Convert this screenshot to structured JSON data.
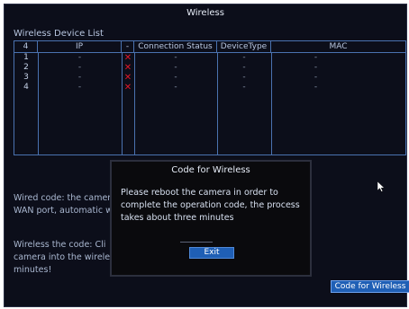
{
  "window": {
    "title": "Wireless"
  },
  "device_list": {
    "label": "Wireless Device List",
    "columns": [
      "4",
      "IP",
      "-",
      "Connection Status",
      "DeviceType",
      "MAC"
    ],
    "rows": [
      {
        "num": "1",
        "ip": "-",
        "status_mark": "✕",
        "connection": "-",
        "type": "-",
        "mac": "-"
      },
      {
        "num": "2",
        "ip": "-",
        "status_mark": "✕",
        "connection": "-",
        "type": "-",
        "mac": "-"
      },
      {
        "num": "3",
        "ip": "-",
        "status_mark": "✕",
        "connection": "-",
        "type": "-",
        "mac": "-"
      },
      {
        "num": "4",
        "ip": "-",
        "status_mark": "✕",
        "connection": "-",
        "type": "-",
        "mac": "-"
      }
    ]
  },
  "background_text": {
    "wired_line1": "Wired code: the camer",
    "wired_line2": "WAN port, automatic w",
    "wireless_line1": "Wireless the code: Cli",
    "wireless_line2": "camera into the wirele",
    "wireless_line3": "minutes!"
  },
  "dialog": {
    "title": "Code for Wireless",
    "message_line1": "Please reboot the camera in order to",
    "message_line2": "complete the operation code, the process",
    "message_line3": "takes about three minutes",
    "exit_label": "Exit"
  },
  "code_button_label": "Code for Wireless",
  "colors": {
    "accent": "#1f5fb5",
    "error": "#e0182a",
    "background": "#0c0e1a"
  },
  "icons": {
    "status": "close-icon",
    "cursor": "mouse-pointer-icon"
  }
}
